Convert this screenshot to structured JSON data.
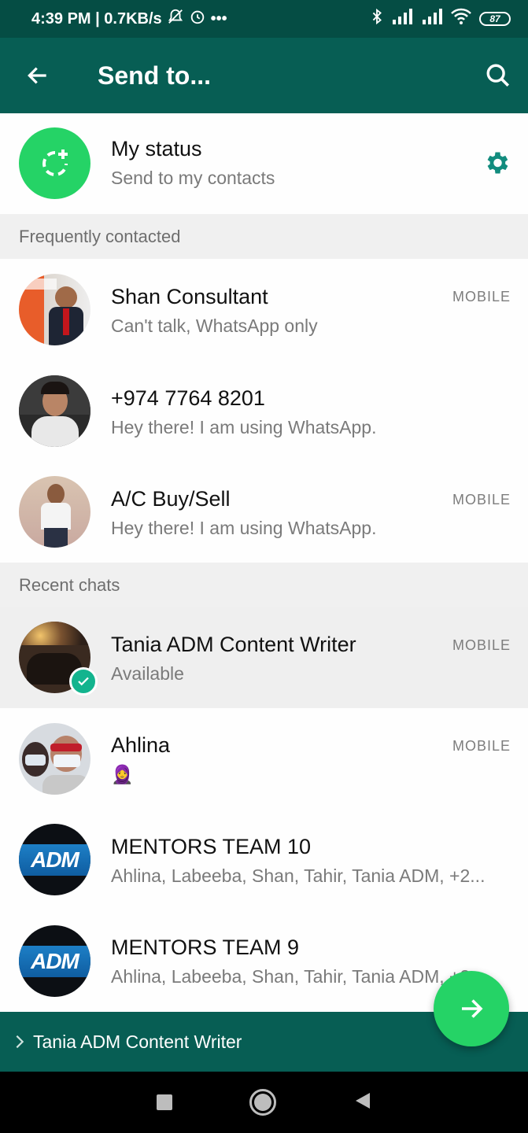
{
  "status_bar": {
    "left_text": "4:39 PM | 0.7KB/s",
    "battery": "87"
  },
  "header": {
    "title": "Send to..."
  },
  "my_status": {
    "name": "My status",
    "subtitle": "Send to my contacts"
  },
  "sections": {
    "frequent": "Frequently contacted",
    "recent": "Recent chats"
  },
  "frequent_contacts": [
    {
      "name": "Shan Consultant",
      "status": "Can't talk, WhatsApp only",
      "tag": "MOBILE"
    },
    {
      "name": "+974 7764 8201",
      "status": "Hey there! I am using WhatsApp.",
      "tag": ""
    },
    {
      "name": "A/C Buy/Sell",
      "status": "Hey there! I am using WhatsApp.",
      "tag": "MOBILE"
    }
  ],
  "recent_chats": [
    {
      "name": "Tania ADM Content Writer",
      "status": "Available",
      "tag": "MOBILE",
      "selected": true
    },
    {
      "name": "Ahlina",
      "status": "🧕",
      "tag": "MOBILE"
    },
    {
      "name": "MENTORS TEAM 10",
      "status": "Ahlina, Labeeba, Shan, Tahir, Tania ADM, +2...",
      "tag": ""
    },
    {
      "name": "MENTORS TEAM 9",
      "status": "Ahlina, Labeeba, Shan, Tahir, Tania ADM, +2...",
      "tag": ""
    }
  ],
  "group_logo_text": "ADM",
  "selection_bar": {
    "text": "Tania ADM Content Writer"
  },
  "colors": {
    "app_bar": "#075e54",
    "status_bar": "#054d44",
    "accent_green": "#25d366",
    "teal": "#128c7e"
  }
}
